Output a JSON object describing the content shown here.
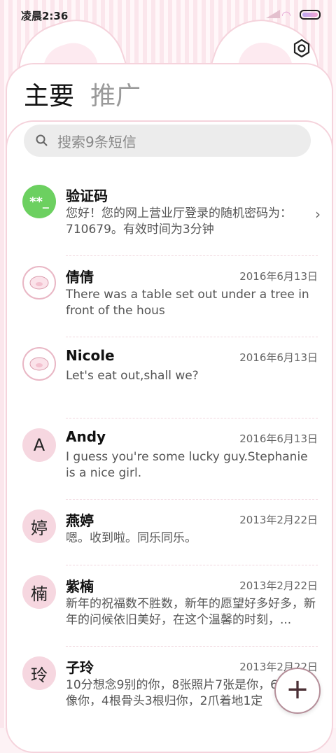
{
  "status": {
    "time": "凌晨2:36"
  },
  "tabs": {
    "main": "主要",
    "promo": "推广"
  },
  "search": {
    "placeholder": "搜索9条短信"
  },
  "messages": [
    {
      "avatar_text": "**_",
      "name": "验证码",
      "date": "",
      "preview": "您好！您的网上营业厅登录的随机密码为：710679。有效时间为3分钟"
    },
    {
      "avatar_text": "",
      "name": "倩倩",
      "date": "2016年6月13日",
      "preview": "There was a table set out under a tree in front of the hous"
    },
    {
      "avatar_text": "",
      "name": "Nicole",
      "date": "2016年6月13日",
      "preview": "Let's eat out,shall we?"
    },
    {
      "avatar_text": "A",
      "name": "Andy",
      "date": "2016年6月13日",
      "preview": "I guess you're some lucky guy.Stephanie is a nice girl."
    },
    {
      "avatar_text": "婷",
      "name": "燕婷",
      "date": "2013年2月22日",
      "preview": "嗯。收到啦。同乐同乐。"
    },
    {
      "avatar_text": "楠",
      "name": "紫楠",
      "date": "2013年2月22日",
      "preview": "新年的祝福数不胜数，新年的愿望好多好多，新年的问候依旧美好，在这个温馨的时刻，..."
    },
    {
      "avatar_text": "玲",
      "name": "子玲",
      "date": "2013年2月22日",
      "preview": "10分想念9别的你，8张照片7张是你，6只5只像你，4根骨头3根归你，2爪着地1定"
    }
  ],
  "fab": {
    "label": "+"
  },
  "colors": {
    "accent_green": "#6cd060",
    "pink_bg": "#fbe6ec",
    "avatar_pink": "#f6d7e0"
  }
}
